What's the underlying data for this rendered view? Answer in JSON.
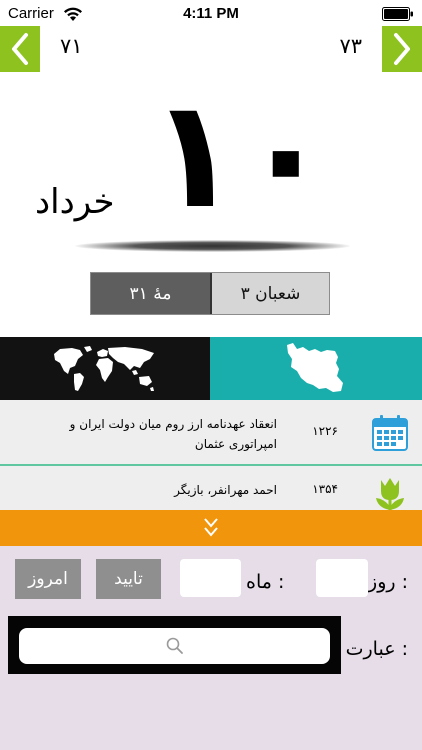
{
  "status_bar": {
    "carrier": "Carrier",
    "time": "4:11 PM",
    "icons": [
      "wifi-icon",
      "battery-icon"
    ]
  },
  "navigation": {
    "prev_day": "۷۱",
    "next_day": "۷۳",
    "prev_icon": "chevron-left-icon",
    "next_icon": "chevron-right-icon",
    "accent_color": "#8dc21f"
  },
  "date_display": {
    "day": "۱۰",
    "month": "خرداد"
  },
  "alt_dates": {
    "hijri": "۳ شعبان",
    "lunar": "۳۱ مهٔ"
  },
  "region_tabs": [
    {
      "id": "world",
      "icon": "world-map-icon",
      "color": "#121212"
    },
    {
      "id": "iran",
      "icon": "iran-map-icon",
      "color": "#19aeac"
    }
  ],
  "events": [
    {
      "year": "۱۲۲۶",
      "text": "انعقاد عهدنامه ارز روم میان دولت ایران و امپراتوری عثمان",
      "icon": "calendar-icon"
    },
    {
      "year": "۱۳۵۴",
      "text": "احمد مهرانفر، بازیگر",
      "icon": "tulip-icon"
    }
  ],
  "expand": {
    "icon": "double-chevron-down-icon",
    "color": "#f0950c"
  },
  "form": {
    "day_label": "روز :",
    "month_label": "ماه :",
    "confirm_label": "تایید",
    "today_label": "امروز",
    "phrase_label": "عبارت :",
    "search_icon": "search-icon",
    "panel_color": "#e6dde9"
  }
}
